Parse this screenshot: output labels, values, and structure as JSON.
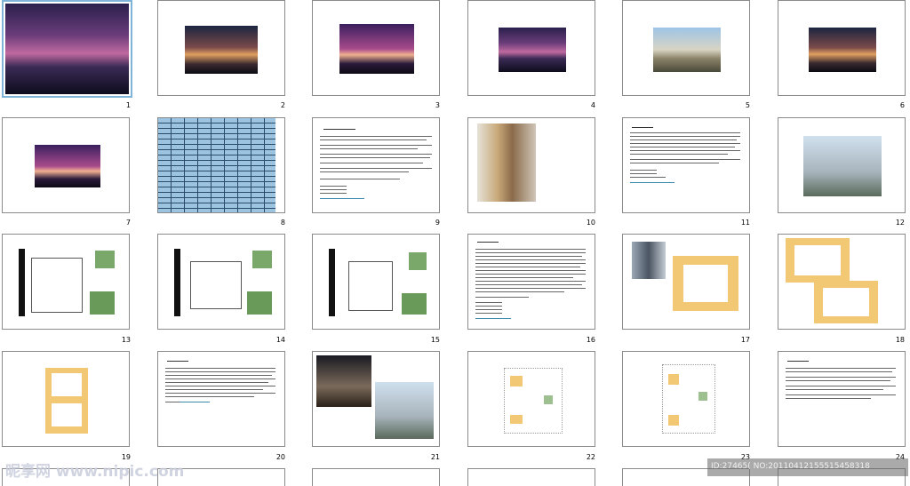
{
  "slides": [
    {
      "number": "1"
    },
    {
      "number": "2"
    },
    {
      "number": "3"
    },
    {
      "number": "4"
    },
    {
      "number": "5"
    },
    {
      "number": "6"
    },
    {
      "number": "7"
    },
    {
      "number": "8"
    },
    {
      "number": "9"
    },
    {
      "number": "10"
    },
    {
      "number": "11"
    },
    {
      "number": "12"
    },
    {
      "number": "13"
    },
    {
      "number": "14"
    },
    {
      "number": "15"
    },
    {
      "number": "16"
    },
    {
      "number": "17"
    },
    {
      "number": "18"
    },
    {
      "number": "19"
    },
    {
      "number": "20"
    },
    {
      "number": "21"
    },
    {
      "number": "22"
    },
    {
      "number": "23"
    },
    {
      "number": "24"
    }
  ],
  "watermark": {
    "logo": "昵享网 www.nipic.com",
    "id_text": "ID:27465(  NO:20110412155515458318"
  },
  "colors": {
    "selection": "#7fb4d8",
    "border": "#8a8a8a"
  }
}
